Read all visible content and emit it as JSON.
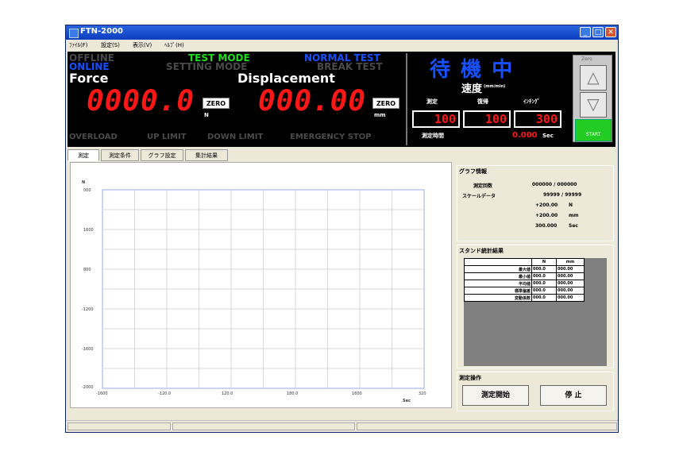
{
  "window": {
    "title": "FTN-2000",
    "menus": [
      "ﾌｧｲﾙ(F)",
      "設定(S)",
      "表示(V)",
      "ﾍﾙﾌﾟ(H)"
    ]
  },
  "status_panel": {
    "offline": "OFFLINE",
    "online": "ONLINE",
    "test_mode": "TEST MODE",
    "setting_mode": "SETTING MODE",
    "normal_test": "NORMAL TEST",
    "break_test": "BREAK TEST",
    "force_label": "Force",
    "force_value": "0000.0",
    "force_unit": "N",
    "displacement_label": "Displacement",
    "displacement_value": "000.00",
    "displacement_unit": "mm",
    "zero_label": "ZERO",
    "overload": "OVERLOAD",
    "up_limit": "UP LIMIT",
    "down_limit": "DOWN LIMIT",
    "emergency_stop": "EMERGENCY STOP",
    "standby": "待 機 中",
    "speed_label": "速度",
    "speed_unit": "(mm/min)",
    "speed_cols": [
      "測定",
      "復帰",
      "ｲﾝﾁﾝｸﾞ"
    ],
    "speed_values": [
      "100",
      "100",
      "300"
    ],
    "time_label": "測定時間",
    "time_value": "0.000",
    "time_unit": "Sec",
    "side_top_label": "Zero",
    "side_bottom_label": "START"
  },
  "tabs": [
    "測定",
    "測定条件",
    "グラフ設定",
    "集計結果"
  ],
  "chart": {
    "y_unit": "N",
    "x_unit": "Sec",
    "y_ticks": [
      "000",
      "1600",
      "800",
      "-1200",
      "-1600",
      "-2000"
    ],
    "x_ticks": [
      "-1600",
      "-120.0",
      "120.0",
      "180.0",
      "1600",
      "320"
    ]
  },
  "graph_info": {
    "title": "グラフ情報",
    "count_label": "測定回数",
    "count_value": "000000 / 000000",
    "scale_label": "スケールデータ",
    "scale_value": "99999 / 99999",
    "r1_value": "+200.00",
    "r1_unit": "N",
    "r2_value": "+200.00",
    "r2_unit": "mm",
    "r3_value": "300.000",
    "r3_unit": "Sec"
  },
  "stand": {
    "title": "スタンド統計結果",
    "headers": [
      "",
      "N",
      "mm"
    ],
    "rows": [
      [
        "最大値",
        "000.0",
        "000.00"
      ],
      [
        "最小値",
        "000.0",
        "000.00"
      ],
      [
        "平均値",
        "000.0",
        "000.00"
      ],
      [
        "標準偏差",
        "000.0",
        "000.00"
      ],
      [
        "変動係数",
        "000.0",
        "000.00"
      ]
    ]
  },
  "operation": {
    "title": "測定操作",
    "start": "測定開始",
    "stop": "停 止"
  }
}
